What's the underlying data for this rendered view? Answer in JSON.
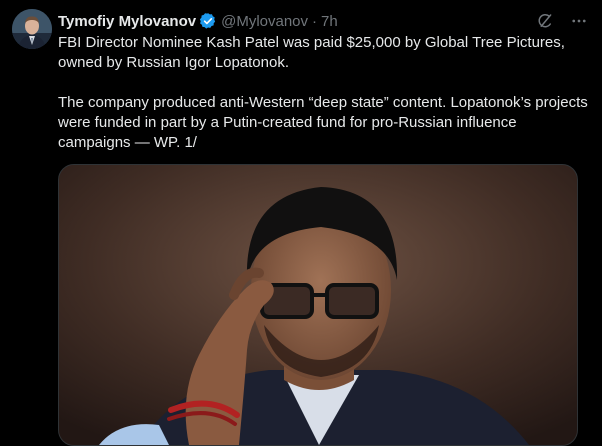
{
  "author": {
    "name": "Tymofiy Mylovanov",
    "handle": "@Mylovanov",
    "separator": "·",
    "time": "7h"
  },
  "tweet": {
    "paragraph1": "FBI Director Nominee Kash Patel was paid $25,000 by Global Tree Pictures, owned by Russian Igor Lopatonok.",
    "paragraph2": "The company produced anti-Western “deep state” content. Lopatonok’s projects were funded in part by a Putin-created fund for pro-Russian influence campaigns — WP. 1/"
  },
  "icons": {
    "verified": "verified-badge-icon",
    "grok": "grok-icon",
    "more": "more-icon"
  },
  "colors": {
    "background": "#000000",
    "text": "#e7e9ea",
    "secondary": "#71767b",
    "verified": "#1d9bf0"
  }
}
